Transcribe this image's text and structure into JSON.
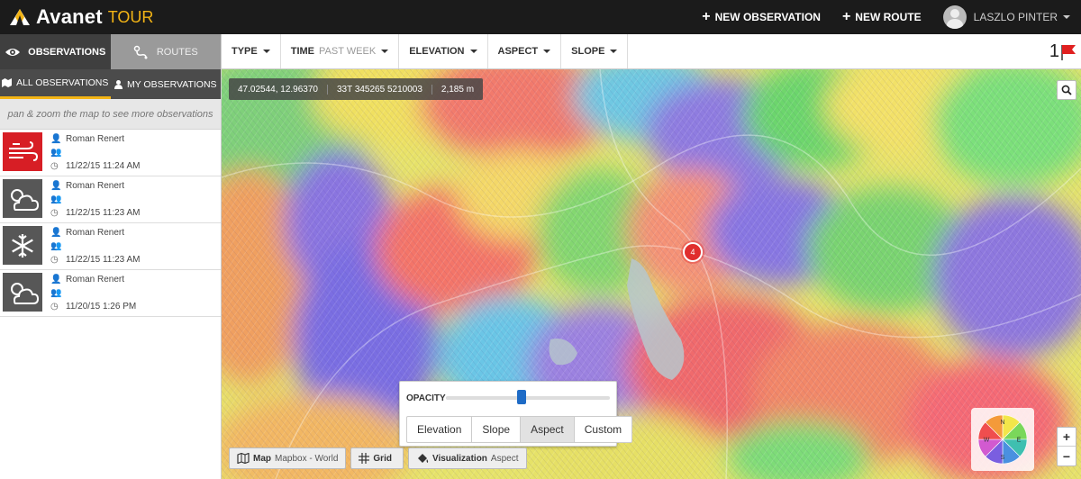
{
  "app": {
    "name": "Avanet",
    "sub": "TOUR"
  },
  "header": {
    "new_observation": "NEW OBSERVATION",
    "new_route": "NEW ROUTE",
    "user_name": "LASZLO PINTER"
  },
  "sidebar": {
    "tabs": [
      {
        "label": "OBSERVATIONS",
        "icon": "eye-icon",
        "active": true
      },
      {
        "label": "ROUTES",
        "icon": "route-icon",
        "active": false
      }
    ],
    "subtabs": [
      {
        "label": "ALL OBSERVATIONS",
        "icon": "map-icon",
        "active": true
      },
      {
        "label": "MY OBSERVATIONS",
        "icon": "user-icon",
        "active": false
      }
    ],
    "hint": "pan & zoom the map to see more observations",
    "observations": [
      {
        "type": "wind-icon",
        "author": "Roman Renert",
        "timestamp": "11/22/15 11:24 AM"
      },
      {
        "type": "cloudy-icon",
        "author": "Roman Renert",
        "timestamp": "11/22/15 11:23 AM"
      },
      {
        "type": "snowflake-icon",
        "author": "Roman Renert",
        "timestamp": "11/22/15 11:23 AM"
      },
      {
        "type": "cloudy-icon",
        "author": "Roman Renert",
        "timestamp": "11/20/15 1:26 PM"
      }
    ]
  },
  "filters": {
    "type": "TYPE",
    "time": "TIME",
    "time_value": "PAST WEEK",
    "elevation": "ELEVATION",
    "aspect": "ASPECT",
    "slope": "SLOPE",
    "flag_count": "1"
  },
  "map": {
    "coords": "47.02544, 12.96370",
    "utm": "33T 345265 5210003",
    "altitude": "2,185 m",
    "cluster_count": "4",
    "opacity_label": "OPACITY",
    "opacity_value": 0.46,
    "viz_modes": [
      "Elevation",
      "Slope",
      "Aspect",
      "Custom"
    ],
    "viz_active": "Aspect",
    "map_btn": "Map",
    "map_value": "Mapbox - World",
    "grid_btn": "Grid",
    "viz_btn": "Visualization",
    "viz_value": "Aspect",
    "compass": [
      "N",
      "E",
      "S",
      "W"
    ],
    "zoom_in": "+",
    "zoom_out": "−"
  },
  "colors": {
    "accent": "#f3b415",
    "topbar": "#1b1b1b",
    "alert_red": "#d71e25",
    "cluster": "#e02e2e"
  }
}
